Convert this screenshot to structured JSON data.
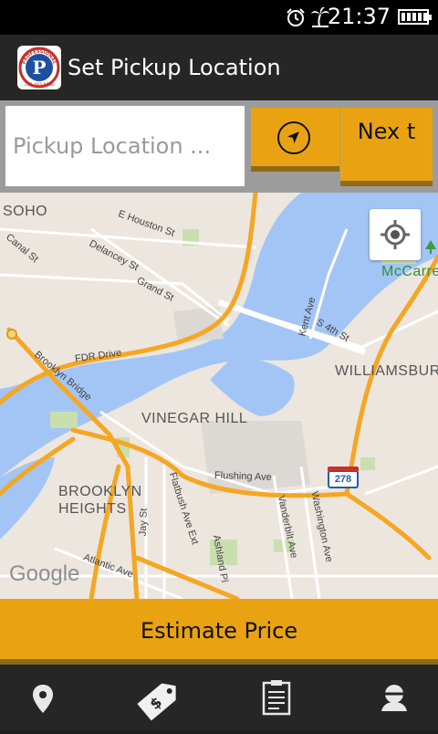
{
  "status_bar": {
    "time": "21:37",
    "icons": [
      "alarm-icon",
      "palm-tree-icon",
      "battery-icon"
    ]
  },
  "app_bar": {
    "logo_text": "PROFESSIONAL",
    "logo_letter": "P",
    "logo_phone": "212-482-8888",
    "title": "Set Pickup Location"
  },
  "search": {
    "placeholder": "Pickup Location ...",
    "value": "",
    "locate_icon": "navigation-arrow-icon",
    "next_label": "Nex t"
  },
  "map": {
    "areas": [
      "SOHO",
      "VINEGAR HILL",
      "BROOKLYN HEIGHTS",
      "WILLIAMSBURG",
      "McCarre"
    ],
    "streets": [
      "E Houston St",
      "Canal St",
      "Delancey St",
      "Grand St",
      "FDR Drive",
      "Brooklyn Bridge",
      "Kent Ave",
      "S 4th St",
      "Flushing Ave",
      "Flatbush Ave Ext",
      "Jay St",
      "Ashland Pl",
      "Vanderbilt Ave",
      "Washington Ave",
      "Atlantic Ave"
    ],
    "highway_shield": "278",
    "attribution": "Google",
    "my_location_icon": "crosshair-icon",
    "park_icon": "tree-icon"
  },
  "estimate_label": "Estimate Price",
  "bottom_nav": [
    {
      "icon": "map-pin-icon"
    },
    {
      "icon": "price-tag-icon"
    },
    {
      "icon": "clipboard-icon"
    },
    {
      "icon": "user-icon"
    }
  ],
  "colors": {
    "accent": "#e9a312",
    "accent_shadow": "#8f6a19",
    "bar": "#262626",
    "water": "#a3c5f5",
    "highway": "#f5a623"
  }
}
